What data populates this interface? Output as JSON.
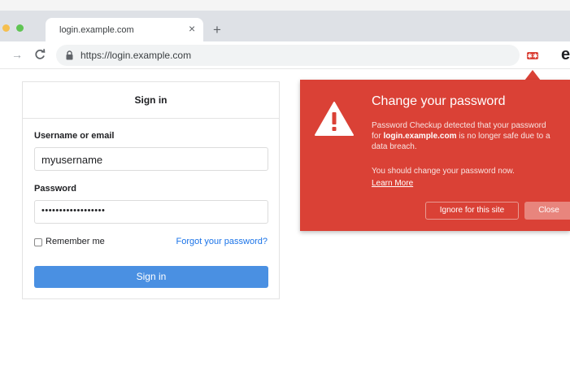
{
  "tab": {
    "title": "login.example.com",
    "close_icon": "×",
    "new_tab_icon": "+"
  },
  "toolbar": {
    "url": "https://login.example.com",
    "forward_icon": "→",
    "profile_glyph": "e"
  },
  "signin": {
    "title": "Sign in",
    "username_label": "Username or email",
    "username_value": "myusername",
    "password_label": "Password",
    "password_value": "••••••••••••••••••",
    "remember_label": "Remember me",
    "forgot_link": "Forgot your password?",
    "submit_label": "Sign in"
  },
  "popup": {
    "title": "Change your password",
    "line1": "Password Checkup detected that your password",
    "line2_prefix": "for ",
    "line2_domain": "login.example.com",
    "line2_suffix": " is no longer safe due to a",
    "line3": "data breach.",
    "advice": "You should change your password now.",
    "learn_more": "Learn More",
    "ignore_button": "Ignore for this site",
    "close_button": "Close"
  },
  "colors": {
    "popup_bg": "#da4136",
    "signin_button": "#4a90e2",
    "link": "#1a73e8"
  }
}
